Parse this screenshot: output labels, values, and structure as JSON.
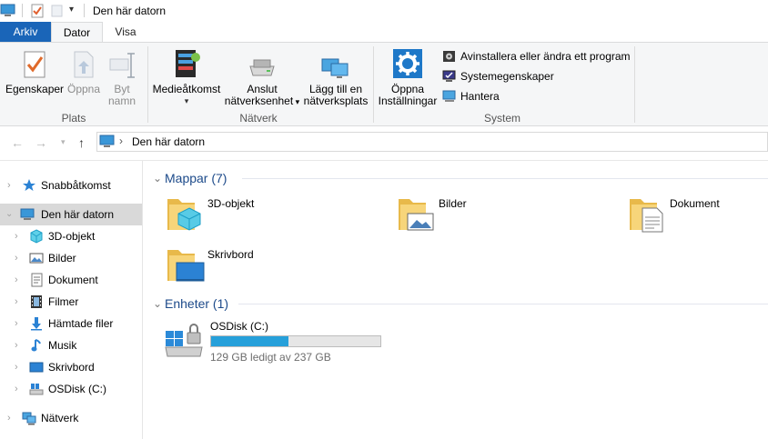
{
  "window": {
    "title": "Den här datorn"
  },
  "ribbon_tabs": [
    {
      "label": "Arkiv"
    },
    {
      "label": "Dator"
    },
    {
      "label": "Visa"
    }
  ],
  "ribbon": {
    "plats": {
      "label": "Plats",
      "egenskaper": "Egenskaper",
      "oppna": "Öppna",
      "byt_namn_1": "Byt",
      "byt_namn_2": "namn"
    },
    "natverk": {
      "label": "Nätverk",
      "medieatkomst": "Medieåtkomst",
      "anslut_1": "Anslut",
      "anslut_2": "nätverksenhet",
      "lagg_till_1": "Lägg till en",
      "lagg_till_2": "nätverksplats"
    },
    "system": {
      "label": "System",
      "oppna_1": "Öppna",
      "oppna_2": "Inställningar",
      "avinstallera": "Avinstallera eller ändra ett program",
      "systemegenskaper": "Systemegenskaper",
      "hantera": "Hantera"
    }
  },
  "address": {
    "path": "Den här datorn"
  },
  "nav_pane": {
    "items": [
      {
        "label": "Snabbåtkomst"
      },
      {
        "label": "Den här datorn"
      },
      {
        "label": "3D-objekt"
      },
      {
        "label": "Bilder"
      },
      {
        "label": "Dokument"
      },
      {
        "label": "Filmer"
      },
      {
        "label": "Hämtade filer"
      },
      {
        "label": "Musik"
      },
      {
        "label": "Skrivbord"
      },
      {
        "label": "OSDisk (C:)"
      },
      {
        "label": "Nätverk"
      }
    ]
  },
  "content": {
    "folders_header": "Mappar (7)",
    "folders": [
      {
        "label": "3D-objekt"
      },
      {
        "label": "Bilder"
      },
      {
        "label": "Dokument"
      },
      {
        "label": "Skrivbord"
      }
    ],
    "devices_header": "Enheter (1)",
    "drive": {
      "label": "OSDisk (C:)",
      "info": "129 GB ledigt av 237 GB",
      "used_fraction": 0.456
    }
  },
  "colors": {
    "accent": "#1a65b8",
    "drive_fill": "#26a0da",
    "header_text": "#1c4a8a"
  }
}
